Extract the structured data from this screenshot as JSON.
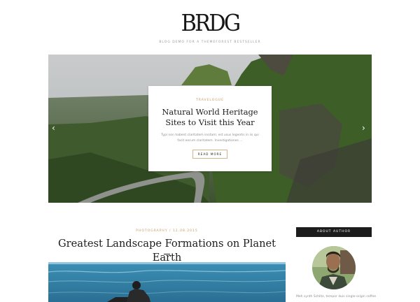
{
  "site": {
    "logo": "BRDG",
    "tagline": "Blog Demo for a Themeforest Bestseller"
  },
  "slider": {
    "prev_icon": "chevron-left-icon",
    "next_icon": "chevron-right-icon",
    "prev_glyph": "‹",
    "next_glyph": "›",
    "card": {
      "category": "Travelogue",
      "title": "Natural World Heritage Sites to Visit this Year",
      "excerpt": "Typi non habent claritatem insitam; est usus legentis in iis qui facit eorum claritatem. Investigationes ...",
      "button": "Read More"
    }
  },
  "post": {
    "meta": "Photography / 12.08.2015",
    "title": "Greatest Landscape Formations on Planet Earth"
  },
  "sidebar": {
    "widget_title": "About Author",
    "author_text": "Meh synth Schlitz, tempor duis single-origin coffee"
  },
  "colors": {
    "accent": "#c59a62",
    "dark": "#1c1c1c",
    "muted": "#8e8e8e"
  }
}
